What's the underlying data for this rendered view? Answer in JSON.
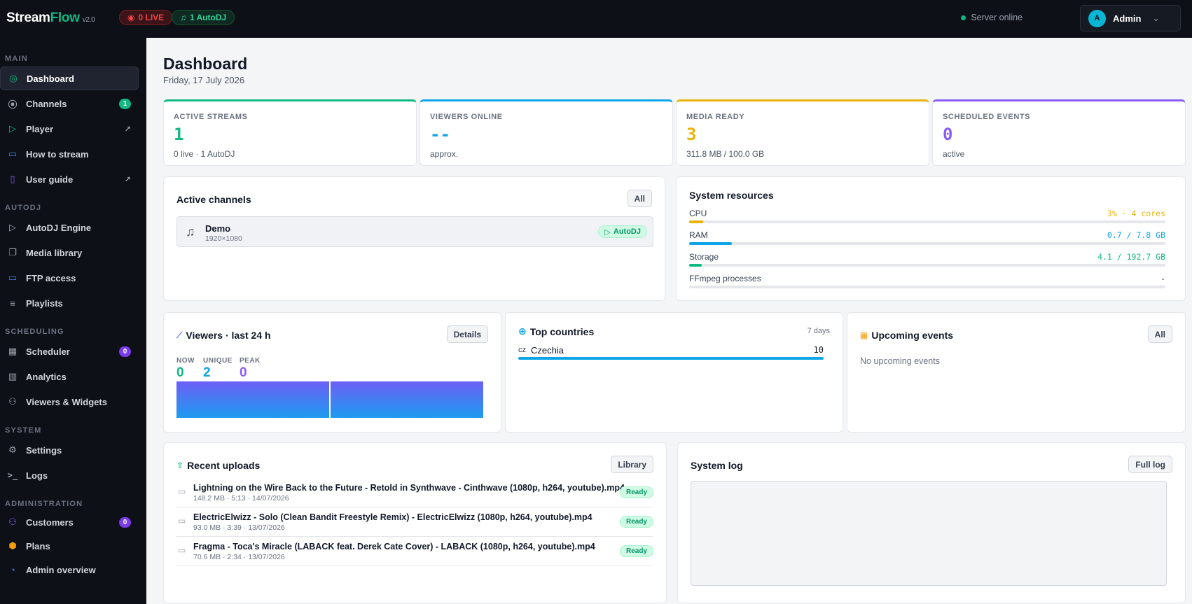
{
  "app": {
    "brand_main": "Stream",
    "brand_accent": "Flow",
    "version": "v2.0"
  },
  "header": {
    "live_pill": "0 LIVE",
    "autodj_pill": "1 AutoDJ",
    "server_status": "Server online",
    "user_initial": "A",
    "user_name": "Admin"
  },
  "sidebar": {
    "sections": {
      "main": "MAIN",
      "autodj": "AUTODJ",
      "scheduling": "SCHEDULING",
      "system": "SYSTEM",
      "administration": "ADMINISTRATION"
    },
    "items": {
      "dashboard": "Dashboard",
      "channels": "Channels",
      "channels_badge": "1",
      "player": "Player",
      "how_to_stream": "How to stream",
      "user_guide": "User guide",
      "autodj_engine": "AutoDJ Engine",
      "media_library": "Media library",
      "ftp_access": "FTP access",
      "playlists": "Playlists",
      "scheduler": "Scheduler",
      "scheduler_badge": "0",
      "analytics": "Analytics",
      "viewers_widgets": "Viewers & Widgets",
      "settings": "Settings",
      "logs": "Logs",
      "customers": "Customers",
      "customers_badge": "0",
      "plans": "Plans",
      "admin_overview": "Admin overview"
    }
  },
  "page": {
    "title": "Dashboard",
    "date": "Friday, 17 July 2026"
  },
  "stats": {
    "active_streams": {
      "label": "ACTIVE STREAMS",
      "value": "1",
      "sub": "0 live · 1 AutoDJ",
      "color": "#10b981"
    },
    "viewers_online": {
      "label": "VIEWERS ONLINE",
      "value": "--",
      "sub": "approx.",
      "color": "#0ea5e9"
    },
    "media_ready": {
      "label": "MEDIA READY",
      "value": "3",
      "sub": "311.8 MB / 100.0 GB",
      "color": "#eab308"
    },
    "scheduled_events": {
      "label": "SCHEDULED EVENTS",
      "value": "0",
      "sub": "active",
      "color": "#8b5cf6"
    }
  },
  "active_channels": {
    "title": "Active channels",
    "button": "All",
    "channel": {
      "name": "Demo",
      "resolution": "1920×1080",
      "tag": "AutoDJ"
    }
  },
  "system_resources": {
    "title": "System resources",
    "cpu": {
      "label": "CPU",
      "value": "3% · 4 cores",
      "fraction": 0.03,
      "color": "#eab308"
    },
    "ram": {
      "label": "RAM",
      "value": "0.7 / 7.8 GB",
      "fraction": 0.09,
      "color": "#0ea5e9"
    },
    "storage": {
      "label": "Storage",
      "value": "4.1 / 192.7 GB",
      "fraction": 0.021,
      "color": "#10b981"
    },
    "ffmpeg": {
      "label": "FFmpeg processes",
      "value": "-",
      "fraction": 0,
      "color": "#374151"
    }
  },
  "viewers": {
    "title": "Viewers · last 24 h",
    "button": "Details",
    "now_label": "NOW",
    "now_value": "0",
    "unique_label": "UNIQUE",
    "unique_value": "2",
    "peak_label": "PEAK",
    "peak_value": "0"
  },
  "top_countries": {
    "title": "Top countries",
    "period": "7 days",
    "rows": [
      {
        "code": "cz",
        "name": "Czechia",
        "count": "10",
        "fraction": 1.0
      }
    ]
  },
  "upcoming_events": {
    "title": "Upcoming events",
    "button": "All",
    "empty": "No upcoming events"
  },
  "recent_uploads": {
    "title": "Recent uploads",
    "button": "Library",
    "items": [
      {
        "name": "Lightning on the Wire Back to the Future - Retold in Synthwave - Cinthwave (1080p, h264, youtube).mp4",
        "meta": "148.2 MB · 5:13 · 14/07/2026",
        "status": "Ready"
      },
      {
        "name": "ElectricElwizz - Solo (Clean Bandit Freestyle Remix) - ElectricElwizz (1080p, h264, youtube).mp4",
        "meta": "93.0 MB · 3:39 · 13/07/2026",
        "status": "Ready"
      },
      {
        "name": "Fragma - Toca's Miracle (LABACK feat. Derek Cate Cover) - LABACK (1080p, h264, youtube).mp4",
        "meta": "70.6 MB · 2:34 · 13/07/2026",
        "status": "Ready"
      }
    ]
  },
  "system_log": {
    "title": "System log",
    "button": "Full log"
  }
}
